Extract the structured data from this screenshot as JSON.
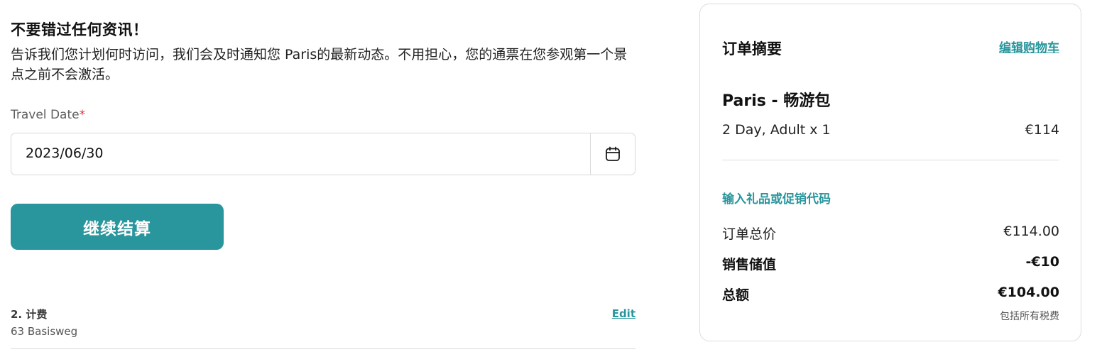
{
  "notice": {
    "title": "不要错过任何资讯！",
    "body": "告诉我们您计划何时访问，我们会及时通知您 Paris的最新动态。不用担心，您的通票在您参观第一个景点之前不会激活。"
  },
  "travel_date": {
    "label": "Travel Date",
    "required_mark": "*",
    "value": "2023/06/30",
    "icon": "calendar-icon"
  },
  "continue_button": {
    "label": "继续结算"
  },
  "billing": {
    "title": "2. 计费",
    "address": "63 Basisweg",
    "edit_label": "Edit"
  },
  "summary": {
    "title": "订单摘要",
    "edit_cart": "编辑购物车",
    "product_name": "Paris - 畅游包",
    "product_detail": "2 Day, Adult x 1",
    "product_price": "€114",
    "promo_link": "输入礼品或促销代码",
    "rows": [
      {
        "label": "订单总价",
        "value": "€114.00"
      },
      {
        "label": "销售储值",
        "value": "-€10"
      },
      {
        "label": "总额",
        "value": "€104.00"
      }
    ],
    "tax_note": "包括所有税费"
  },
  "colors": {
    "accent": "#29959c",
    "required": "#d0343c",
    "border": "#d9d9d9"
  }
}
